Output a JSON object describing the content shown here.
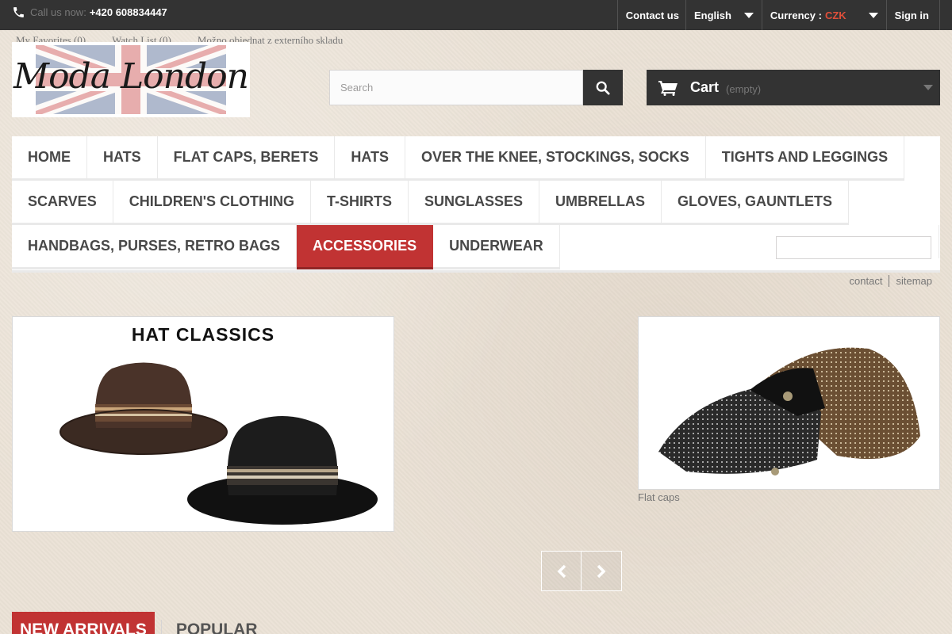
{
  "topbar": {
    "call_label": "Call us now:",
    "phone_number": "+420 608834447",
    "phone_icon": "phone-icon",
    "nav": {
      "contact": "Contact us",
      "language": "English",
      "currency_label": "Currency :",
      "currency_value": "CZK",
      "signin": "Sign in"
    }
  },
  "favrow": {
    "favorites": "My Favorites (0)",
    "watchlist": "Watch List (0)",
    "external": "Možno objednat z externího skladu"
  },
  "logo": {
    "text": "Moda London"
  },
  "search": {
    "placeholder": "Search",
    "icon": "search-icon"
  },
  "cart": {
    "label": "Cart",
    "status": "(empty)",
    "icon": "cart-icon"
  },
  "menu": {
    "row1": [
      "Home",
      "Hats",
      "Flat caps, berets",
      "Hats",
      "Over the knee, stockings, socks",
      "Tights and leggings"
    ],
    "row2": [
      "Scarves",
      "Children's clothing",
      "T-shirts",
      "Sunglasses",
      "Umbrellas",
      "Gloves, gauntlets"
    ],
    "row3": [
      "Handbags, purses, retro bags",
      "Accessories",
      "Underwear"
    ],
    "active": "Accessories"
  },
  "links": {
    "contact": "contact",
    "sitemap": "sitemap"
  },
  "slider": {
    "slide1_title": "HAT CLASSICS",
    "slide3_caption": "Flat caps",
    "prev_icon": "chevron-left-icon",
    "next_icon": "chevron-right-icon"
  },
  "tabs": {
    "new_arrivals": "New arrivals",
    "popular": "Popular"
  },
  "colors": {
    "topbar": "#333333",
    "accent": "#c13333",
    "currency": "#e04f3a"
  }
}
